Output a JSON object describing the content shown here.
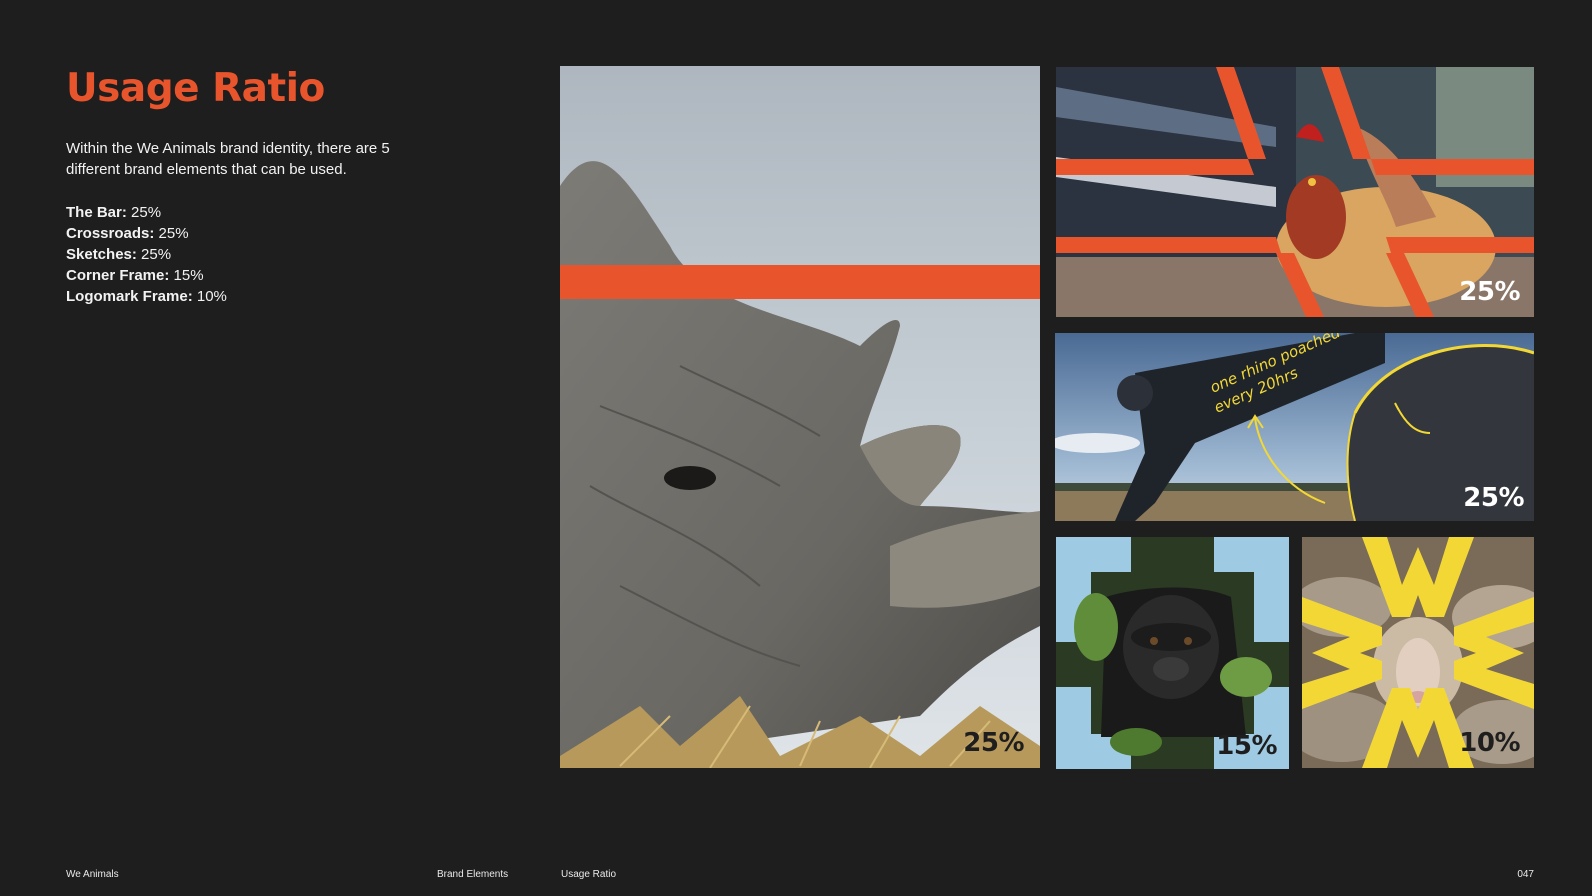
{
  "page": {
    "title": "Usage Ratio",
    "intro": "Within the We Animals brand identity, there are 5 different brand elements that can be used."
  },
  "ratios": [
    {
      "label": "The Bar:",
      "value": "25%"
    },
    {
      "label": "Crossroads:",
      "value": "25%"
    },
    {
      "label": "Sketches:",
      "value": "25%"
    },
    {
      "label": "Corner Frame:",
      "value": "15%"
    },
    {
      "label": "Logomark Frame:",
      "value": "10%"
    }
  ],
  "tiles": {
    "rhino": {
      "percent": "25%"
    },
    "rooster": {
      "percent": "25%"
    },
    "sketch": {
      "percent": "25%",
      "annotation_line1": "one rhino poached",
      "annotation_line2": "every 20hrs"
    },
    "gorilla": {
      "percent": "15%"
    },
    "sheep": {
      "percent": "10%"
    }
  },
  "colors": {
    "background": "#1e1e1e",
    "accent_orange": "#e8552d",
    "sky_blue": "#9ecbe3",
    "brand_yellow": "#f3d835"
  },
  "footer": {
    "brand": "We Animals",
    "section": "Brand Elements",
    "page_name": "Usage Ratio",
    "page_number": "047"
  }
}
